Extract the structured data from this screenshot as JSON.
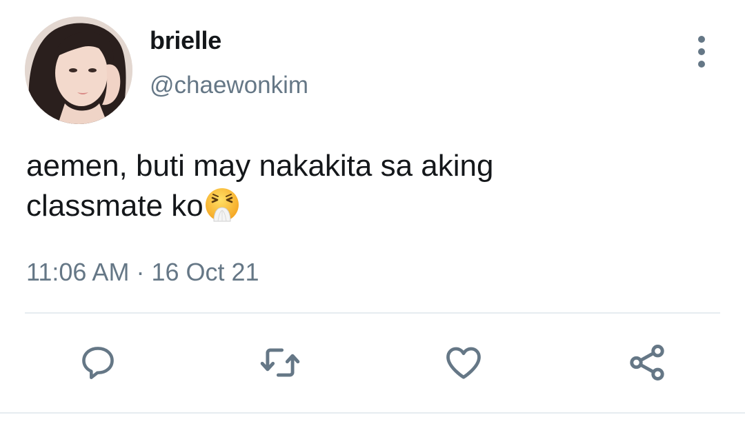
{
  "tweet": {
    "author": {
      "display_name": "brielle",
      "handle": "@chaewonkim",
      "avatar_icon": "profile-photo"
    },
    "text": {
      "line1": "aemen, buti may nakakita sa aking",
      "line2": "classmate ko",
      "emoji": "sneezing-face"
    },
    "time": "11:06 AM",
    "separator": "·",
    "date": "16 Oct 21"
  },
  "menu": {
    "icon": "more-vertical-icon"
  },
  "actions": [
    {
      "name": "reply",
      "icon": "reply-icon"
    },
    {
      "name": "retweet",
      "icon": "retweet-icon"
    },
    {
      "name": "like",
      "icon": "heart-icon"
    },
    {
      "name": "share",
      "icon": "share-icon"
    }
  ],
  "colors": {
    "text_primary": "#14171a",
    "text_secondary": "#657786",
    "divider": "#e6ecf0",
    "background": "#ffffff"
  }
}
